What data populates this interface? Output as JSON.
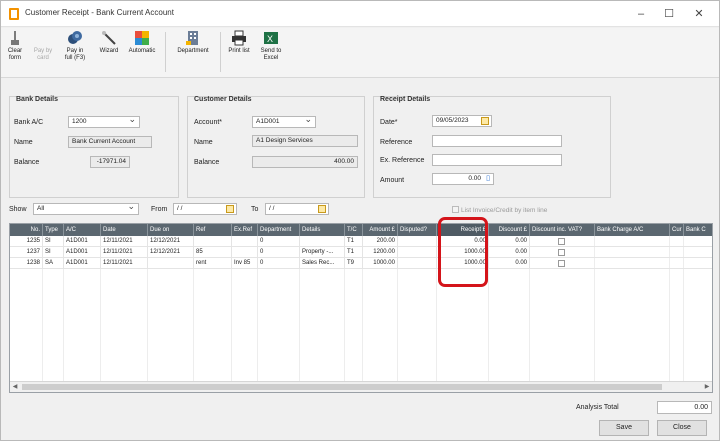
{
  "window": {
    "title": "Customer Receipt - Bank Current Account",
    "minimize_glyph": "–",
    "maximize_glyph": "☐",
    "close_glyph": "✕"
  },
  "toolbar": {
    "clear_form": "Clear\nform",
    "pay_by_card": "Pay by\ncard",
    "pay_in_full": "Pay in\nfull (F3)",
    "wizard": "Wizard",
    "automatic": "Automatic",
    "department": "Department",
    "print_list": "Print list",
    "send_to_excel": "Send to\nExcel"
  },
  "bank_details": {
    "title": "Bank Details",
    "bank_ac_label": "Bank A/C",
    "bank_ac_value": "1200",
    "name_label": "Name",
    "name_value": "Bank Current Account",
    "balance_label": "Balance",
    "balance_value": "-17971.04"
  },
  "customer_details": {
    "title": "Customer Details",
    "account_label": "Account*",
    "account_value": "A1D001",
    "name_label": "Name",
    "name_value": "A1 Design Services",
    "balance_label": "Balance",
    "balance_value": "400.00"
  },
  "receipt_details": {
    "title": "Receipt Details",
    "date_label": "Date*",
    "date_value": "09/05/2023",
    "reference_label": "Reference",
    "reference_value": "",
    "ex_reference_label": "Ex. Reference",
    "ex_reference_value": "",
    "amount_label": "Amount",
    "amount_value": "0.00"
  },
  "filter": {
    "show_label": "Show",
    "show_value": "All",
    "from_label": "From",
    "from_value": "/ /",
    "to_label": "To",
    "to_value": "/ /",
    "list_invoice_label": "List Invoice/Credit by item line"
  },
  "grid": {
    "columns": [
      "No.",
      "Type",
      "A/C",
      "Date",
      "Due on",
      "Ref",
      "Ex.Ref",
      "Department",
      "Details",
      "T/C",
      "Amount £",
      "Disputed?",
      "Receipt £",
      "Discount £",
      "Discount inc. VAT?",
      "Bank Charge A/C",
      "Cur",
      "Bank C"
    ],
    "rows": [
      {
        "no": "1235",
        "type": "SI",
        "ac": "A1D001",
        "date": "12/11/2021",
        "due": "12/12/2021",
        "ref": "",
        "exref": "",
        "dept": "0",
        "details": "",
        "tc": "T1",
        "amount": "200.00",
        "disputed": "",
        "receipt": "0.00",
        "discount": "0.00"
      },
      {
        "no": "1237",
        "type": "SI",
        "ac": "A1D001",
        "date": "12/11/2021",
        "due": "12/12/2021",
        "ref": "85",
        "exref": "",
        "dept": "0",
        "details": "Property -...",
        "tc": "T1",
        "amount": "1200.00",
        "disputed": "",
        "receipt": "1000.00",
        "discount": "0.00"
      },
      {
        "no": "1238",
        "type": "SA",
        "ac": "A1D001",
        "date": "12/11/2021",
        "due": "",
        "ref": "rent",
        "exref": "Inv 85",
        "dept": "0",
        "details": "Sales Rec...",
        "tc": "T9",
        "amount": "1000.00",
        "disputed": "",
        "receipt": "1000.00",
        "discount": "0.00"
      }
    ]
  },
  "footer": {
    "analysis_total_label": "Analysis Total",
    "analysis_total_value": "0.00",
    "save_label": "Save",
    "close_label": "Close"
  },
  "colors": {
    "grid_header": "#5b6770",
    "highlight": "#d4141a",
    "excel_green": "#1e7145"
  }
}
